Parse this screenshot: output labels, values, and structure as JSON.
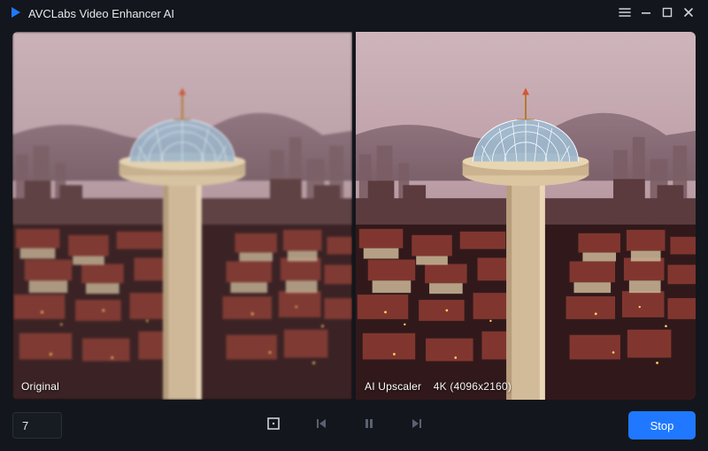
{
  "app": {
    "title": "AVCLabs Video Enhancer AI"
  },
  "titlebar_icons": {
    "menu": "menu",
    "minimize": "minimize",
    "maximize": "maximize",
    "close": "close"
  },
  "preview": {
    "left": {
      "label": "Original"
    },
    "right": {
      "label": "AI Upscaler",
      "resolution": "4K (4096x2160)"
    }
  },
  "bottombar": {
    "frame_value": "7",
    "controls": {
      "crop": {
        "icon": "crop",
        "enabled": true
      },
      "prev": {
        "icon": "prev",
        "enabled": false
      },
      "pause": {
        "icon": "pause",
        "enabled": false
      },
      "next": {
        "icon": "next",
        "enabled": false
      }
    },
    "stop_label": "Stop"
  },
  "colors": {
    "accent": "#1f78ff",
    "bg": "#13161c"
  }
}
